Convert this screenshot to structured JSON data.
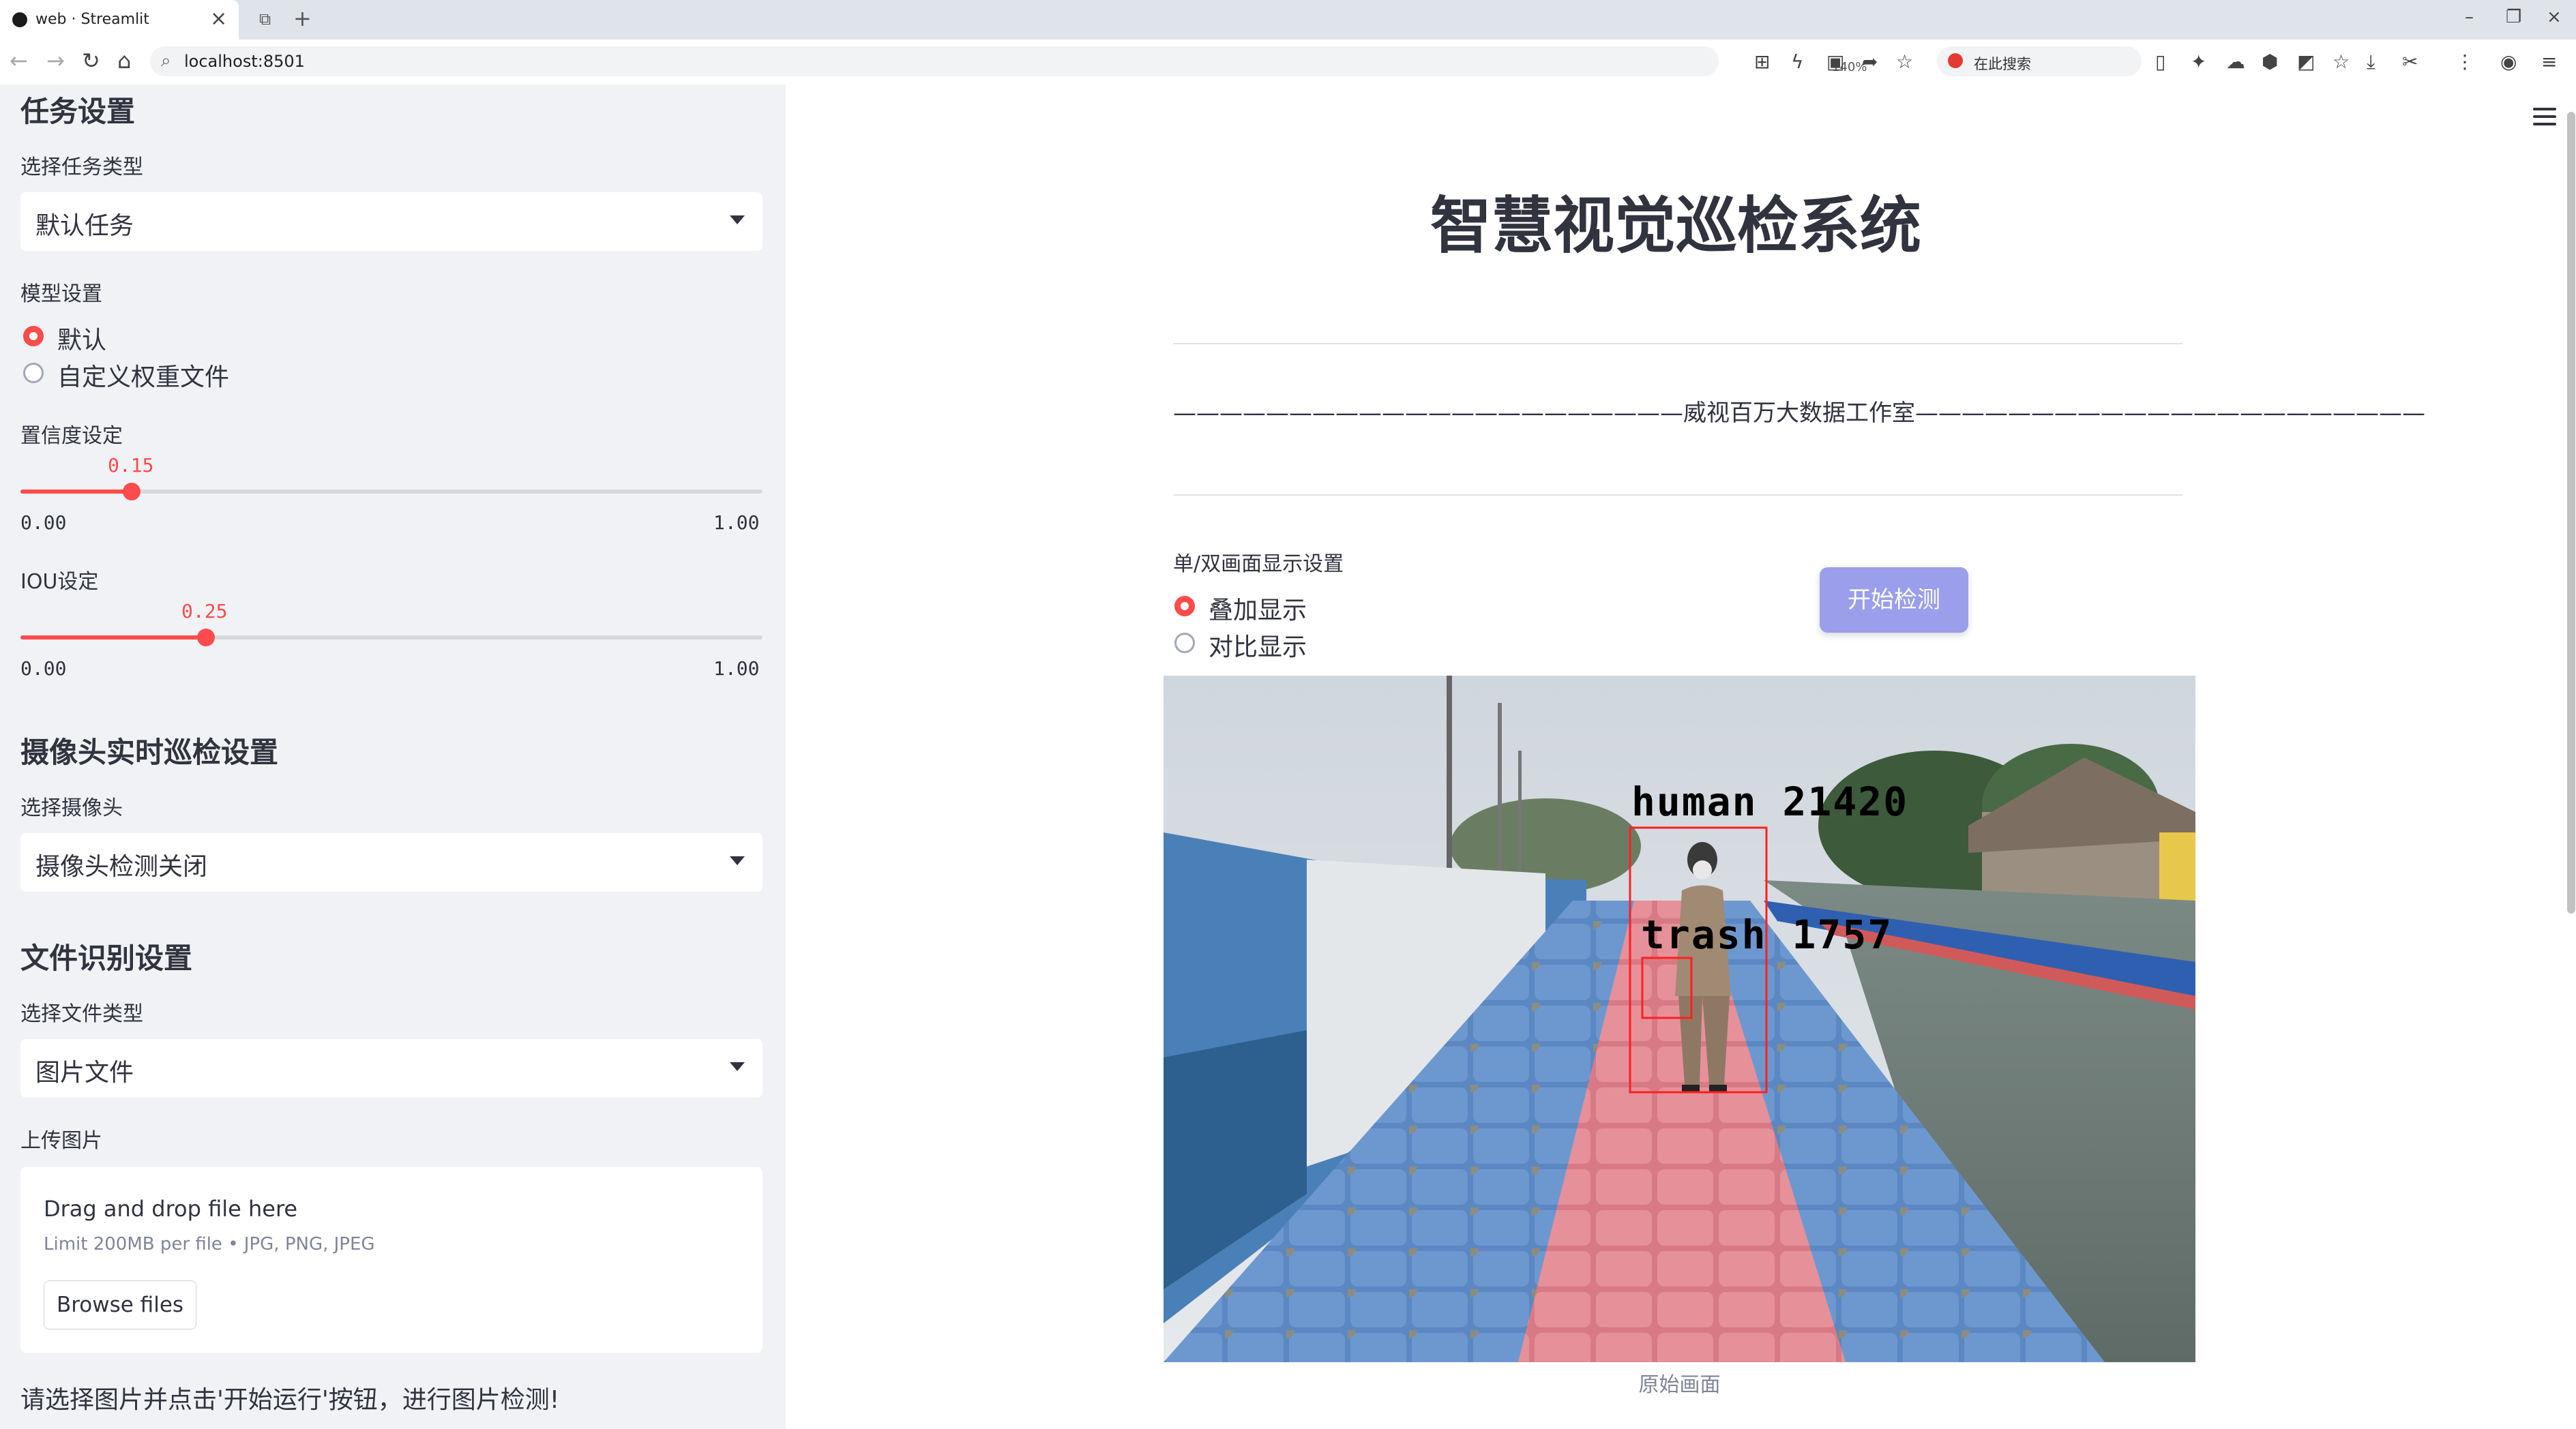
{
  "browser": {
    "tab_title": "web · Streamlit",
    "url": "localhost:8501",
    "zoom": "140%",
    "search_placeholder": "在此搜索"
  },
  "sidebar": {
    "task_section": "任务设置",
    "task_type_label": "选择任务类型",
    "task_type_value": "默认任务",
    "model_label": "模型设置",
    "model_options": [
      "默认",
      "自定义权重文件"
    ],
    "model_selected": 0,
    "conf_label": "置信度设定",
    "conf_value": "0.15",
    "conf_min": "0.00",
    "conf_max": "1.00",
    "iou_label": "IOU设定",
    "iou_value": "0.25",
    "iou_min": "0.00",
    "iou_max": "1.00",
    "camera_section": "摄像头实时巡检设置",
    "camera_label": "选择摄像头",
    "camera_value": "摄像头检测关闭",
    "file_section": "文件识别设置",
    "file_type_label": "选择文件类型",
    "file_type_value": "图片文件",
    "upload_label": "上传图片",
    "drop_title": "Drag and drop file here",
    "drop_limit": "Limit 200MB per file • JPG, PNG, JPEG",
    "browse_label": "Browse files",
    "tip": "请选择图片并点击'开始运行'按钮，进行图片检测!"
  },
  "main": {
    "title": "智慧视觉巡检系统",
    "subtitle": "——————————————————————威视百万大数据工作室——————————————————————",
    "display_label": "单/双画面显示设置",
    "display_options": [
      "叠加显示",
      "对比显示"
    ],
    "display_selected": 0,
    "start_button": "开始检测",
    "image_caption": "原始画面",
    "detections": [
      {
        "label": "human 21420"
      },
      {
        "label": "trash 1757"
      }
    ]
  },
  "colors": {
    "accent": "#ff4b4b",
    "button": "#9a9eeb",
    "detection_box": "#ff2020",
    "detection_text": "#22dd22"
  }
}
